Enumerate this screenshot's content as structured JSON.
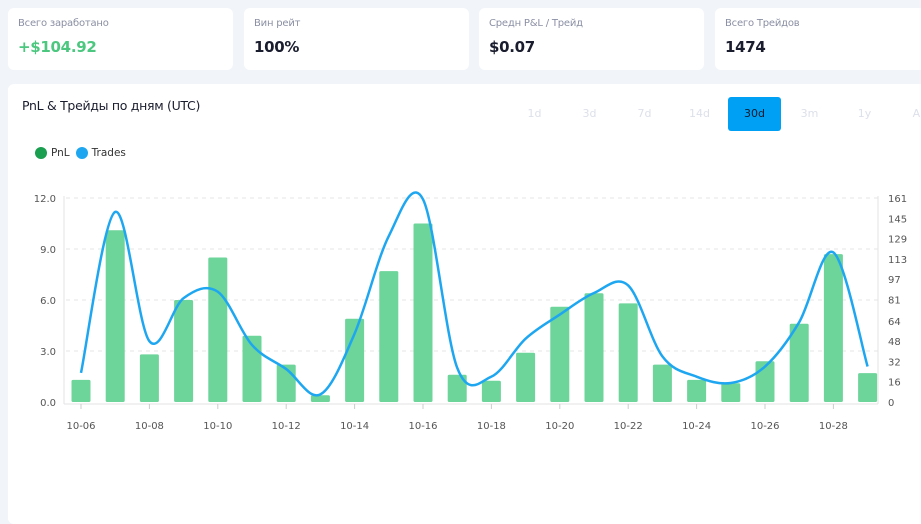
{
  "stats": [
    {
      "label": "Всего заработано",
      "value": "+$104.92"
    },
    {
      "label": "Вин рейт",
      "value": "100%"
    },
    {
      "label": "Средн P&L / Трейд",
      "value": "$0.07"
    },
    {
      "label": "Всего Трейдов",
      "value": "1474"
    }
  ],
  "chart_panel": {
    "title": "PnL & Трейды по дням (UTC)",
    "ranges": [
      "1d",
      "3d",
      "7d",
      "14d",
      "30d",
      "3m",
      "1y",
      "All"
    ],
    "active_range": "30d"
  },
  "colors": {
    "pnl": "#6dd49a",
    "trades": "#1ea7f0",
    "accent": "#00a0f5",
    "positive": "#4cc77f"
  },
  "chart_data": {
    "type": "bar+line",
    "legend_position": "top-left",
    "grid": true,
    "x": [
      "10-06",
      "10-07",
      "10-08",
      "10-09",
      "10-10",
      "10-11",
      "10-12",
      "10-13",
      "10-14",
      "10-15",
      "10-16",
      "10-17",
      "10-18",
      "10-19",
      "10-20",
      "10-21",
      "10-22",
      "10-23",
      "10-24",
      "10-25",
      "10-26",
      "10-27",
      "10-28",
      "10-29"
    ],
    "x_tick_labels": [
      "10-06",
      "10-08",
      "10-10",
      "10-12",
      "10-14",
      "10-16",
      "10-18",
      "10-20",
      "10-22",
      "10-24",
      "10-26",
      "10-28"
    ],
    "series": [
      {
        "name": "PnL",
        "type": "bar",
        "axis": "left",
        "values": [
          1.3,
          10.1,
          2.8,
          6.0,
          8.5,
          3.9,
          2.2,
          0.4,
          4.9,
          7.7,
          10.5,
          1.6,
          1.25,
          2.9,
          5.6,
          6.4,
          5.8,
          2.2,
          1.3,
          1.1,
          2.4,
          4.6,
          8.7,
          1.7
        ]
      },
      {
        "name": "Trades",
        "type": "line",
        "axis": "right",
        "values": [
          23,
          150,
          48,
          82,
          87,
          45,
          26,
          6,
          54,
          131,
          160,
          27,
          20,
          50,
          69,
          86,
          92,
          36,
          20,
          15,
          28,
          63,
          118,
          28
        ]
      }
    ],
    "y_left": {
      "range": [
        0,
        12
      ],
      "ticks": [
        "0.0",
        "3.0",
        "6.0",
        "9.0",
        "12.0"
      ]
    },
    "y_right": {
      "range": [
        0,
        161
      ],
      "ticks": [
        "0",
        "16",
        "32",
        "48",
        "64",
        "81",
        "97",
        "113",
        "129",
        "145",
        "161"
      ]
    }
  }
}
